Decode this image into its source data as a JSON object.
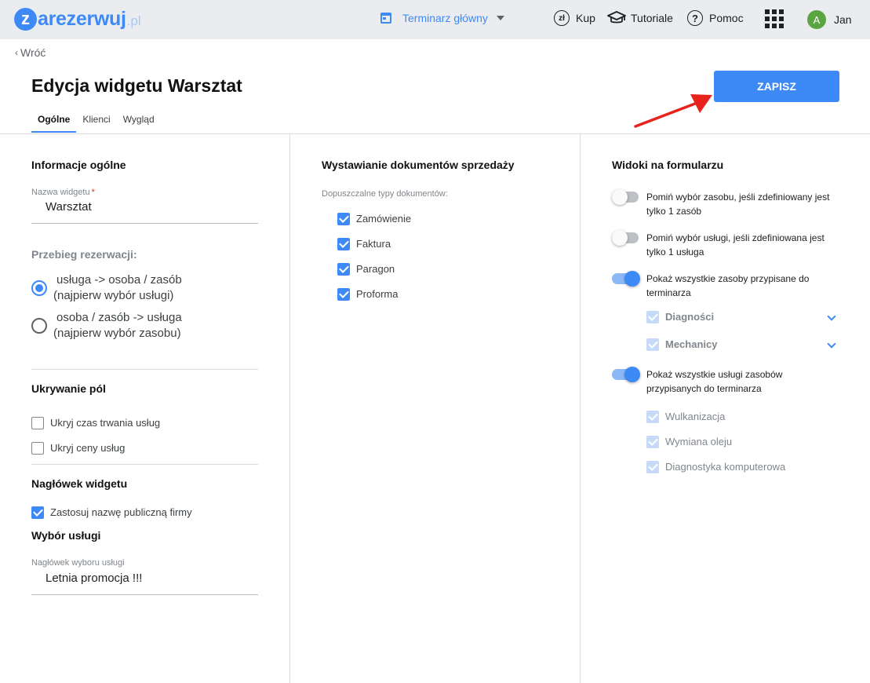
{
  "topbar": {
    "logo_letter": "z",
    "logo_text": "arezerwuj",
    "logo_tld": ".pl",
    "calendar_label": "Terminarz główny",
    "buy_icon_text": "zł",
    "buy_label": "Kup",
    "tutorials_label": "Tutoriale",
    "help_label": "Pomoc",
    "avatar_initial": "A",
    "user_name": "Jan"
  },
  "header": {
    "back_label": "Wróć",
    "title": "Edycja widgetu Warsztat",
    "save_label": "ZAPISZ",
    "tabs": [
      {
        "label": "Ogólne"
      },
      {
        "label": "Klienci"
      },
      {
        "label": "Wygląd"
      }
    ]
  },
  "general": {
    "title": "Informacje ogólne",
    "widget_name_label": "Nazwa widgetu",
    "required_mark": "*",
    "widget_name_value": "Warsztat",
    "flow_label": "Przebieg rezerwacji:",
    "flow_options": [
      {
        "line1": "usługa -> osoba / zasób",
        "line2": "(najpierw wybór usługi)",
        "selected": true
      },
      {
        "line1": "osoba / zasób -> usługa",
        "line2": "(najpierw wybór zasobu)",
        "selected": false
      }
    ],
    "hide_title": "Ukrywanie pól",
    "hide_options": [
      {
        "label": "Ukryj czas trwania usług",
        "checked": false
      },
      {
        "label": "Ukryj ceny usług",
        "checked": false
      }
    ],
    "header_title": "Nagłówek widgetu",
    "public_name_label": "Zastosuj nazwę publiczną firmy",
    "public_name_checked": true,
    "service_title": "Wybór usługi",
    "service_header_label": "Nagłówek wyboru usługi",
    "service_header_value": "Letnia promocja !!!"
  },
  "sales": {
    "title": "Wystawianie dokumentów sprzedaży",
    "allowed_label": "Dopuszczalne typy dokumentów:",
    "documents": [
      {
        "label": "Zamówienie",
        "checked": true
      },
      {
        "label": "Faktura",
        "checked": true
      },
      {
        "label": "Paragon",
        "checked": true
      },
      {
        "label": "Proforma",
        "checked": true
      }
    ]
  },
  "views": {
    "title": "Widoki na formularzu",
    "toggles": [
      {
        "line1": "Pomiń wybór zasobu, jeśli zdefiniowany jest",
        "line2": "tylko 1 zasób",
        "on": false
      },
      {
        "line1": "Pomiń wybór usługi, jeśli zdefiniowana jest",
        "line2": "tylko 1 usługa",
        "on": false
      },
      {
        "line1": "Pokaż wszystkie zasoby przypisane do",
        "line2": "terminarza",
        "on": true
      },
      {
        "line1": "Pokaż wszystkie usługi zasobów",
        "line2": "przypisanych do terminarza",
        "on": true
      }
    ],
    "resource_groups": [
      {
        "label": "Diagności"
      },
      {
        "label": "Mechanicy"
      }
    ],
    "services": [
      {
        "label": "Wulkanizacja"
      },
      {
        "label": "Wymiana oleju"
      },
      {
        "label": "Diagnostyka komputerowa"
      }
    ]
  },
  "colors": {
    "accent": "#3d8af7",
    "topbar_bg": "#eaecef",
    "annotation_arrow": "#e8231c"
  },
  "icons": [
    "calendar-icon",
    "caret-down-icon",
    "currency-icon",
    "graduation-cap-icon",
    "help-icon",
    "apps-grid-icon",
    "chevron-left-icon",
    "chevron-down-icon",
    "check-icon"
  ]
}
